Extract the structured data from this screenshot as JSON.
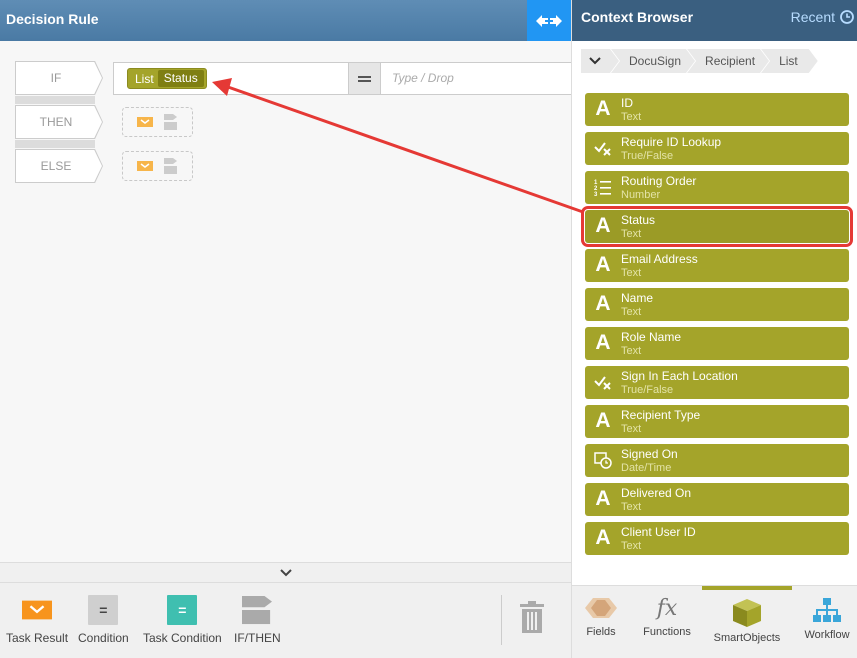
{
  "left_panel": {
    "title": "Decision Rule",
    "rows": {
      "if_label": "IF",
      "then_label": "THEN",
      "else_label": "ELSE"
    },
    "condition": {
      "chip_prefix": "List",
      "chip_value": "Status",
      "rhs_placeholder": "Type / Drop"
    },
    "toolbox": [
      {
        "label": "Task Result"
      },
      {
        "label": "Condition"
      },
      {
        "label": "Task Condition"
      },
      {
        "label": "IF/THEN"
      }
    ]
  },
  "right_panel": {
    "title": "Context Browser",
    "recent_label": "Recent",
    "breadcrumb": [
      "DocuSign",
      "Recipient",
      "List"
    ],
    "fields": [
      {
        "name": "ID",
        "type": "Text",
        "icon": "text-icon"
      },
      {
        "name": "Require ID Lookup",
        "type": "True/False",
        "icon": "boolean-icon"
      },
      {
        "name": "Routing Order",
        "type": "Number",
        "icon": "number-icon"
      },
      {
        "name": "Status",
        "type": "Text",
        "icon": "text-icon",
        "selected": true
      },
      {
        "name": "Email Address",
        "type": "Text",
        "icon": "text-icon"
      },
      {
        "name": "Name",
        "type": "Text",
        "icon": "text-icon"
      },
      {
        "name": "Role Name",
        "type": "Text",
        "icon": "text-icon"
      },
      {
        "name": "Sign In Each Location",
        "type": "True/False",
        "icon": "boolean-icon"
      },
      {
        "name": "Recipient Type",
        "type": "Text",
        "icon": "text-icon"
      },
      {
        "name": "Signed On",
        "type": "Date/Time",
        "icon": "datetime-icon"
      },
      {
        "name": "Delivered On",
        "type": "Text",
        "icon": "text-icon"
      },
      {
        "name": "Client User ID",
        "type": "Text",
        "icon": "text-icon"
      }
    ],
    "tabs": [
      {
        "label": "Fields"
      },
      {
        "label": "Functions"
      },
      {
        "label": "SmartObjects",
        "active": true
      },
      {
        "label": "Workflow"
      }
    ]
  },
  "colors": {
    "field_bg": "#a4a42a",
    "header_left": "#5f8db5",
    "header_right": "#3a5f80",
    "highlight": "#e53935",
    "accent_blue": "#2196f3"
  }
}
